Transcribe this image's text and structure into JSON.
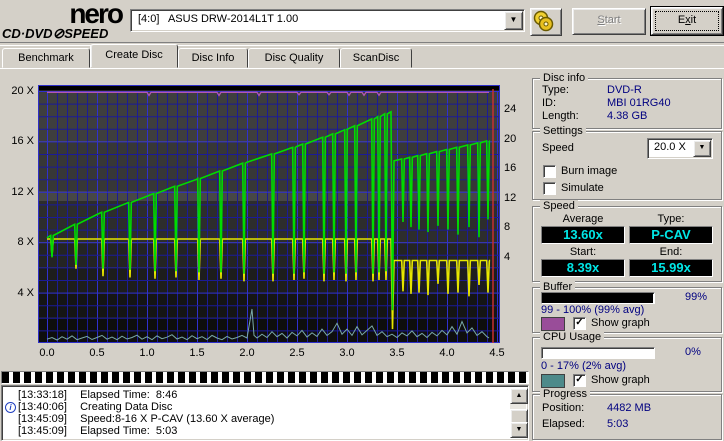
{
  "logo": {
    "line1": "nero",
    "line2_left": "CD·DVD",
    "line2_right": "SPEED",
    "disc_glyph": "⊘"
  },
  "toolbar": {
    "drive": "[4:0]   ASUS DRW-2014L1T 1.00",
    "start_label": "Start",
    "start_accel": 0,
    "exit_label": "Exit",
    "exit_accel": 1
  },
  "tabs": {
    "items": [
      {
        "label": "Benchmark",
        "w": 86
      },
      {
        "label": "Create Disc",
        "w": 86
      },
      {
        "label": "Disc Info",
        "w": 68
      },
      {
        "label": "Disc Quality",
        "w": 90
      },
      {
        "label": "ScanDisc",
        "w": 70
      }
    ],
    "selected": 1
  },
  "chart_data": {
    "type": "line",
    "x_unit": "GB",
    "x_ticks": [
      "0.0",
      "0.5",
      "1.0",
      "1.5",
      "2.0",
      "2.5",
      "3.0",
      "3.5",
      "4.0",
      "4.5"
    ],
    "y_left_ticks": [
      {
        "v": 20,
        "label": "20 X"
      },
      {
        "v": 16,
        "label": "16 X"
      },
      {
        "v": 12,
        "label": "12 X"
      },
      {
        "v": 8,
        "label": "8 X"
      },
      {
        "v": 4,
        "label": "4 X"
      }
    ],
    "y_right_ticks": [
      {
        "v": 24,
        "label": "24"
      },
      {
        "v": 20,
        "label": "20"
      },
      {
        "v": 16,
        "label": "16"
      },
      {
        "v": 12,
        "label": "12"
      },
      {
        "v": 8,
        "label": "8"
      },
      {
        "v": 4,
        "label": "4"
      }
    ],
    "xlim": [
      0,
      4.5
    ],
    "ylim_left": [
      0,
      20
    ],
    "grid": true,
    "capacity_line_x": 4.46,
    "colors": {
      "write_speed": "#00dc00",
      "rpm": "#e6e600",
      "cpu": "#7aa9a9",
      "buffer": "#b257b2",
      "capacity": "#c83030",
      "grid_minor": "#1b1b96",
      "grid_major": "#3030cf",
      "border": "#2d2dc8"
    },
    "bands": [
      [
        20.48,
        20.02,
        "#000000"
      ],
      [
        20.02,
        16,
        "#3e3e3e"
      ],
      [
        16,
        12,
        "#373737"
      ],
      [
        12,
        11.3,
        "#474747"
      ],
      [
        11.3,
        8,
        "#2d2d2d"
      ],
      [
        8,
        6,
        "#242424"
      ],
      [
        6,
        4,
        "#1d1d1d"
      ],
      [
        4,
        2,
        "#151515"
      ],
      [
        2,
        0,
        "#0e0e0e"
      ],
      [
        0,
        -0.46,
        "#0a0a0a"
      ]
    ],
    "series": [
      {
        "name": "write-speed",
        "color_key": "write_speed",
        "pre_anchors": [
          [
            0,
            8.35
          ],
          [
            0.5,
            10.2
          ],
          [
            1.0,
            11.65
          ],
          [
            1.5,
            13.0
          ],
          [
            2.0,
            14.35
          ],
          [
            2.5,
            15.6
          ],
          [
            3.0,
            16.95
          ],
          [
            3.44,
            18.35
          ]
        ],
        "pre_spikes": [
          [
            0.05,
            6.8
          ],
          [
            0.29,
            6.2
          ],
          [
            0.56,
            5.9
          ],
          [
            0.83,
            5.8
          ],
          [
            1.08,
            5.7
          ],
          [
            1.29,
            5.7
          ],
          [
            1.52,
            5.6
          ],
          [
            1.74,
            5.6
          ],
          [
            1.97,
            5.5
          ],
          [
            2.26,
            5.5
          ],
          [
            2.47,
            5.5
          ],
          [
            2.57,
            5.6
          ],
          [
            2.77,
            5.5
          ],
          [
            2.87,
            5.6
          ],
          [
            2.99,
            5.5
          ],
          [
            3.09,
            5.6
          ],
          [
            3.26,
            5.5
          ],
          [
            3.32,
            5.6
          ],
          [
            3.39,
            5.7
          ]
        ],
        "break_point": [
          3.455,
          2.6
        ],
        "post_anchors": [
          [
            3.47,
            14.45
          ],
          [
            4.42,
            16.05
          ]
        ],
        "post_spikes": [
          [
            3.56,
            9.6
          ],
          [
            3.64,
            9.2
          ],
          [
            3.72,
            9.0
          ],
          [
            3.81,
            8.8
          ],
          [
            3.91,
            9.3
          ],
          [
            4.01,
            9.0
          ],
          [
            4.11,
            8.6
          ],
          [
            4.22,
            9.2
          ],
          [
            4.32,
            8.4
          ],
          [
            4.41,
            9.8
          ]
        ]
      },
      {
        "name": "rotation-speed",
        "color_key": "rpm",
        "pre_anchors": [
          [
            0,
            8.25
          ],
          [
            3.44,
            8.25
          ]
        ],
        "pre_spikes": [
          [
            0.05,
            6.9
          ],
          [
            0.29,
            5.9
          ],
          [
            0.56,
            5.3
          ],
          [
            0.83,
            5.2
          ],
          [
            1.08,
            5.1
          ],
          [
            1.29,
            5.2
          ],
          [
            1.52,
            5.0
          ],
          [
            1.74,
            5.1
          ],
          [
            1.97,
            4.9
          ],
          [
            2.26,
            4.9
          ],
          [
            2.47,
            5.0
          ],
          [
            2.57,
            5.1
          ],
          [
            2.77,
            4.9
          ],
          [
            2.87,
            5.0
          ],
          [
            2.99,
            4.9
          ],
          [
            3.09,
            5.0
          ],
          [
            3.26,
            4.9
          ],
          [
            3.32,
            5.0
          ],
          [
            3.39,
            5.0
          ]
        ],
        "break_point": [
          3.455,
          1.1
        ],
        "post_anchors": [
          [
            3.47,
            6.55
          ],
          [
            4.42,
            6.55
          ]
        ],
        "post_spikes": [
          [
            3.56,
            4.1
          ],
          [
            3.64,
            3.9
          ],
          [
            3.72,
            4.0
          ],
          [
            3.81,
            3.8
          ],
          [
            3.91,
            4.7
          ],
          [
            4.01,
            3.9
          ],
          [
            4.11,
            4.0
          ],
          [
            4.22,
            3.7
          ],
          [
            4.32,
            4.6
          ],
          [
            4.41,
            4.0
          ]
        ]
      }
    ],
    "buffer_pct": [
      [
        0,
        99.5
      ],
      [
        1.0,
        99.5
      ],
      [
        1.02,
        98.2
      ],
      [
        1.04,
        99.5
      ],
      [
        1.7,
        99.5
      ],
      [
        1.72,
        98.2
      ],
      [
        1.74,
        99.5
      ],
      [
        2.1,
        99.5
      ],
      [
        2.12,
        98.2
      ],
      [
        2.14,
        99.5
      ],
      [
        2.5,
        99.5
      ],
      [
        2.52,
        98.5
      ],
      [
        2.54,
        99.5
      ],
      [
        2.8,
        99.5
      ],
      [
        2.82,
        98.5
      ],
      [
        2.84,
        99.5
      ],
      [
        3.0,
        99.5
      ],
      [
        3.02,
        98.3
      ],
      [
        3.04,
        99.5
      ],
      [
        3.15,
        99.5
      ],
      [
        3.17,
        98.3
      ],
      [
        3.19,
        99.5
      ],
      [
        3.3,
        99.5
      ],
      [
        3.32,
        98.3
      ],
      [
        3.34,
        99.5
      ],
      [
        4.42,
        99.5
      ]
    ],
    "cpu_pct": [
      [
        0,
        1.5
      ],
      [
        0.05,
        2.2
      ],
      [
        0.1,
        1.2
      ],
      [
        0.15,
        2.5
      ],
      [
        0.2,
        1.5
      ],
      [
        0.25,
        2.8
      ],
      [
        0.3,
        1.3
      ],
      [
        0.35,
        2.0
      ],
      [
        0.4,
        2.6
      ],
      [
        0.45,
        1.4
      ],
      [
        0.5,
        2.2
      ],
      [
        0.55,
        3.0
      ],
      [
        0.6,
        1.5
      ],
      [
        0.65,
        2.4
      ],
      [
        0.7,
        1.3
      ],
      [
        0.75,
        2.7
      ],
      [
        0.8,
        1.6
      ],
      [
        0.85,
        2.2
      ],
      [
        0.9,
        3.1
      ],
      [
        0.95,
        1.5
      ],
      [
        1.0,
        2.5
      ],
      [
        1.05,
        1.3
      ],
      [
        1.1,
        2.8
      ],
      [
        1.15,
        1.7
      ],
      [
        1.2,
        2.3
      ],
      [
        1.25,
        3.3
      ],
      [
        1.3,
        1.6
      ],
      [
        1.35,
        2.4
      ],
      [
        1.4,
        1.3
      ],
      [
        1.45,
        2.9
      ],
      [
        1.5,
        1.7
      ],
      [
        1.55,
        2.5
      ],
      [
        1.6,
        1.4
      ],
      [
        1.65,
        3.0
      ],
      [
        1.7,
        2.0
      ],
      [
        1.75,
        1.3
      ],
      [
        1.8,
        2.6
      ],
      [
        1.85,
        1.6
      ],
      [
        1.9,
        2.2
      ],
      [
        1.95,
        3.0
      ],
      [
        2.0,
        2.0
      ],
      [
        2.05,
        13.5
      ],
      [
        2.07,
        3.0
      ],
      [
        2.1,
        2.0
      ],
      [
        2.15,
        3.5
      ],
      [
        2.2,
        2.2
      ],
      [
        2.25,
        4.5
      ],
      [
        2.3,
        2.5
      ],
      [
        2.35,
        3.8
      ],
      [
        2.4,
        2.0
      ],
      [
        2.45,
        4.2
      ],
      [
        2.5,
        2.8
      ],
      [
        2.55,
        5.0
      ],
      [
        2.6,
        2.4
      ],
      [
        2.65,
        4.0
      ],
      [
        2.7,
        2.6
      ],
      [
        2.75,
        5.5
      ],
      [
        2.8,
        3.0
      ],
      [
        2.85,
        4.5
      ],
      [
        2.9,
        7.8
      ],
      [
        2.95,
        3.5
      ],
      [
        3.0,
        5.5
      ],
      [
        3.05,
        3.0
      ],
      [
        3.1,
        6.5
      ],
      [
        3.15,
        3.2
      ],
      [
        3.2,
        5.0
      ],
      [
        3.25,
        6.8
      ],
      [
        3.3,
        3.0
      ],
      [
        3.35,
        4.5
      ],
      [
        3.4,
        2.5
      ],
      [
        3.45,
        3.5
      ],
      [
        3.5,
        2.2
      ],
      [
        3.55,
        4.0
      ],
      [
        3.6,
        2.8
      ],
      [
        3.65,
        4.8
      ],
      [
        3.7,
        2.5
      ],
      [
        3.75,
        3.8
      ],
      [
        3.8,
        2.2
      ],
      [
        3.85,
        4.2
      ],
      [
        3.9,
        2.8
      ],
      [
        3.95,
        5.0
      ],
      [
        4.0,
        3.2
      ],
      [
        4.05,
        6.5
      ],
      [
        4.1,
        3.5
      ],
      [
        4.15,
        8.5
      ],
      [
        4.2,
        4.0
      ],
      [
        4.25,
        6.0
      ],
      [
        4.3,
        3.0
      ],
      [
        4.35,
        4.5
      ],
      [
        4.4,
        2.5
      ],
      [
        4.42,
        2.0
      ]
    ]
  },
  "panel": {
    "disc_info": {
      "title": "Disc info",
      "rows": [
        {
          "label": "Type:",
          "value": "DVD-R"
        },
        {
          "label": "ID:",
          "value": "MBI 01RG40"
        },
        {
          "label": "Length:",
          "value": "4.38 GB"
        }
      ]
    },
    "settings": {
      "title": "Settings",
      "speed_label": "Speed",
      "speed_value": "20.0 X",
      "burn_image_label": "Burn image",
      "simulate_label": "Simulate"
    },
    "speed": {
      "title": "Speed",
      "average_label": "Average",
      "type_label": "Type:",
      "start_label": "Start:",
      "end_label": "End:",
      "average": "13.60x",
      "type": "P-CAV",
      "start": "8.39x",
      "end": "15.99x"
    },
    "buffer": {
      "title": "Buffer",
      "pct": "99%",
      "fill": 99,
      "range": "99 - 100% (99% avg)",
      "show_graph_label": "Show graph",
      "swatch": "#994d99",
      "checked": true
    },
    "cpu": {
      "title": "CPU Usage",
      "pct": "0%",
      "fill": 0,
      "range": "0 - 17% (2% avg)",
      "show_graph_label": "Show graph",
      "swatch": "#4d8a8a",
      "checked": true
    },
    "progress": {
      "title": "Progress",
      "position_label": "Position:",
      "position": "4482 MB",
      "elapsed_label": "Elapsed:",
      "elapsed": "5:03"
    }
  },
  "log": {
    "lines": [
      {
        "time": "[13:33:18]",
        "text": "Elapsed Time:  8:46",
        "icon": false
      },
      {
        "time": "[13:40:06]",
        "text": "Creating Data Disc",
        "icon": true
      },
      {
        "time": "[13:45:09]",
        "text": "Speed:8-16 X P-CAV (13.60 X average)",
        "icon": false
      },
      {
        "time": "[13:45:09]",
        "text": "Elapsed Time:  5:03",
        "icon": false
      }
    ]
  }
}
